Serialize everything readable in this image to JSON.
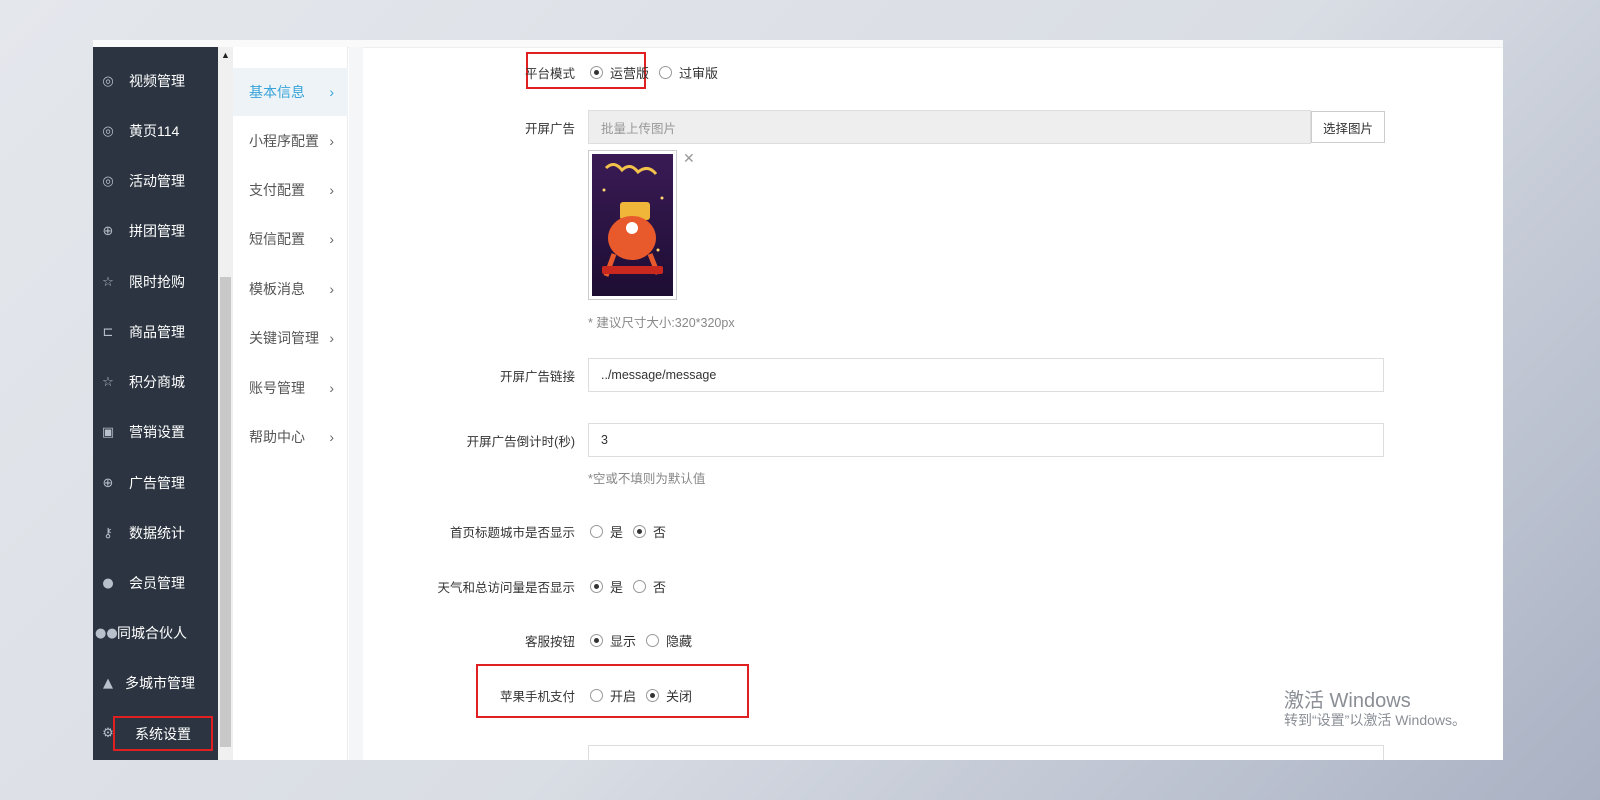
{
  "sidebar": {
    "items": [
      {
        "label": "视频管理",
        "icon": "compass-icon"
      },
      {
        "label": "黄页114",
        "icon": "compass-icon"
      },
      {
        "label": "活动管理",
        "icon": "compass-icon"
      },
      {
        "label": "拼团管理",
        "icon": "lifebuoy-icon"
      },
      {
        "label": "限时抢购",
        "icon": "star-icon"
      },
      {
        "label": "商品管理",
        "icon": "cart-icon"
      },
      {
        "label": "积分商城",
        "icon": "star-icon"
      },
      {
        "label": "营销设置",
        "icon": "gift-icon"
      },
      {
        "label": "广告管理",
        "icon": "lifebuoy-icon"
      },
      {
        "label": "数据统计",
        "icon": "key-icon"
      },
      {
        "label": "会员管理",
        "icon": "user-icon"
      },
      {
        "label": "同城合伙人",
        "icon": "users-icon"
      },
      {
        "label": "多城市管理",
        "icon": "graduation-cap-icon"
      },
      {
        "label": "系统设置",
        "icon": "gear-icon"
      }
    ]
  },
  "subnav": {
    "items": [
      {
        "label": "基本信息"
      },
      {
        "label": "小程序配置"
      },
      {
        "label": "支付配置"
      },
      {
        "label": "短信配置"
      },
      {
        "label": "模板消息"
      },
      {
        "label": "关键词管理"
      },
      {
        "label": "账号管理"
      },
      {
        "label": "帮助中心"
      }
    ],
    "arrow": "›"
  },
  "form": {
    "platform_mode": {
      "label": "平台模式",
      "options": [
        "运营版",
        "过审版"
      ],
      "selected": "运营版"
    },
    "splash_ad": {
      "label": "开屏广告",
      "placeholder": "批量上传图片",
      "button": "选择图片",
      "hint": "* 建议尺寸大小:320*320px",
      "close": "✕"
    },
    "splash_link": {
      "label": "开屏广告链接",
      "value": "../message/message"
    },
    "splash_countdown": {
      "label": "开屏广告倒计时(秒)",
      "value": "3",
      "hint": "*空或不填则为默认值"
    },
    "city_title": {
      "label": "首页标题城市是否显示",
      "options": [
        "是",
        "否"
      ],
      "selected": "否"
    },
    "weather": {
      "label": "天气和总访问量是否显示",
      "options": [
        "是",
        "否"
      ],
      "selected": "是"
    },
    "service_button": {
      "label": "客服按钮",
      "options": [
        "显示",
        "隐藏"
      ],
      "selected": "显示"
    },
    "apple_pay": {
      "label": "苹果手机支付",
      "options": [
        "开启",
        "关闭"
      ],
      "selected": "关闭"
    }
  },
  "watermark": {
    "title": "激活 Windows",
    "subtitle": "转到“设置”以激活 Windows。"
  },
  "colors": {
    "sidebar_bg": "#2b3440",
    "accent": "#36a3d9",
    "highlight_red": "#e02020"
  }
}
